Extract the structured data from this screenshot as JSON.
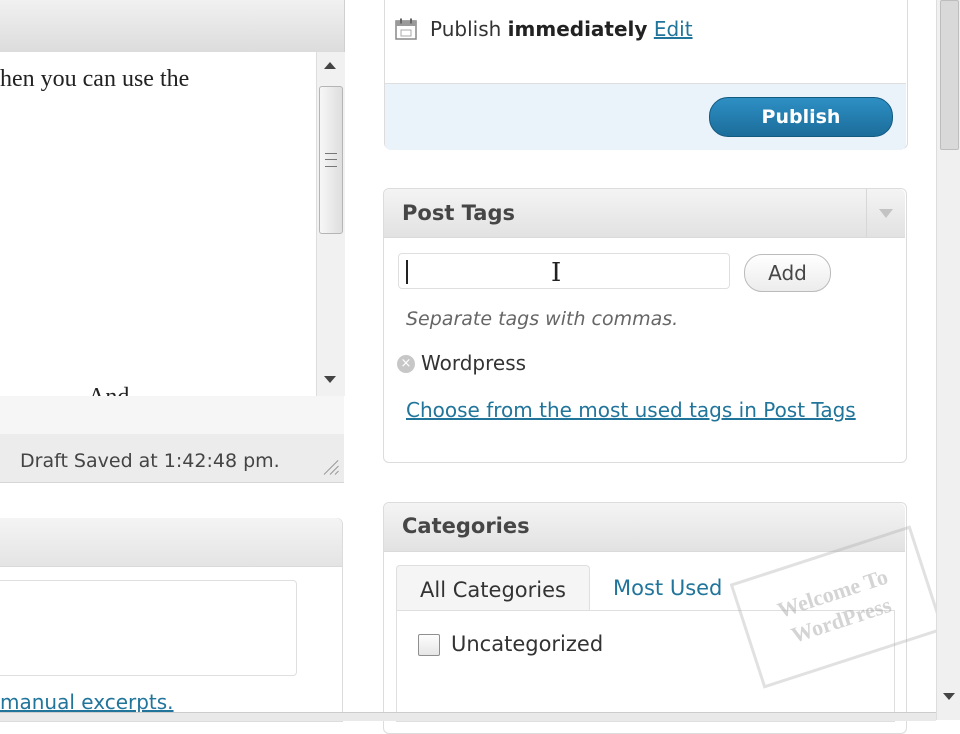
{
  "editor": {
    "text_line1": "hen you can use the",
    "text_line2": "And",
    "status": "Draft Saved at 1:42:48 pm."
  },
  "excerpt": {
    "link": "manual excerpts."
  },
  "publish": {
    "prefix": "Publish",
    "when": "immediately",
    "edit_link": "Edit",
    "button": "Publish"
  },
  "post_tags": {
    "title": "Post Tags",
    "input_value": "",
    "add_button": "Add",
    "hint": "Separate tags with commas.",
    "remove_symbol": "×",
    "tags": [
      "Wordpress"
    ],
    "choose_link": "Choose from the most used tags in Post Tags"
  },
  "categories": {
    "title": "Categories",
    "tabs": [
      "All Categories",
      "Most Used"
    ],
    "items": [
      {
        "label": "Uncategorized",
        "checked": false
      }
    ]
  },
  "watermark": {
    "line1": "Welcome To",
    "line2": "WordPress"
  },
  "icons": {
    "calendar": "calendar-icon",
    "toggle": "triangle-down-icon",
    "tag_remove": "x-circle-icon"
  },
  "colors": {
    "link": "#21759b",
    "publish_button": "#21759b",
    "publish_actions_bg": "#eaf2fa"
  }
}
